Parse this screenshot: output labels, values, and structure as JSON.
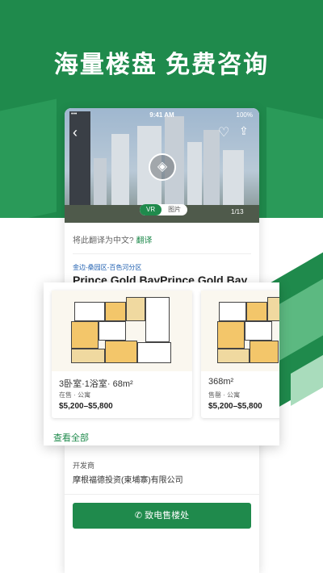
{
  "headline": "海量楼盘  免费咨询",
  "status_bar": {
    "time": "9:41 AM",
    "battery": "100%",
    "signal": "•••"
  },
  "media": {
    "vr_label": "VR",
    "photo_label": "图片",
    "counter": "1/13"
  },
  "translate": {
    "prompt": "将此翻译为中文?",
    "link": "翻译"
  },
  "property": {
    "location": "金边-桑园区-百色河分区",
    "name": "Prince Gold BayPrince Gold Bay"
  },
  "units": [
    {
      "title": "3卧室·1浴室· 68m²",
      "status": "在售 · 公寓",
      "price": "$5,200–$5,800"
    },
    {
      "title": "368m²",
      "status": "售罄 · 公寓",
      "price": "$5,200–$5,800"
    }
  ],
  "see_all": "查看全部",
  "developer": {
    "label": "开发商",
    "name": "摩根福德投资(柬埔寨)有限公司"
  },
  "call_button": "致电售楼处",
  "colors": {
    "brand_green": "#1f8a4c",
    "link_blue": "#1f5fb0"
  },
  "icons": [
    "back-icon",
    "heart-icon",
    "share-icon",
    "cube-3d-icon",
    "phone-icon"
  ]
}
